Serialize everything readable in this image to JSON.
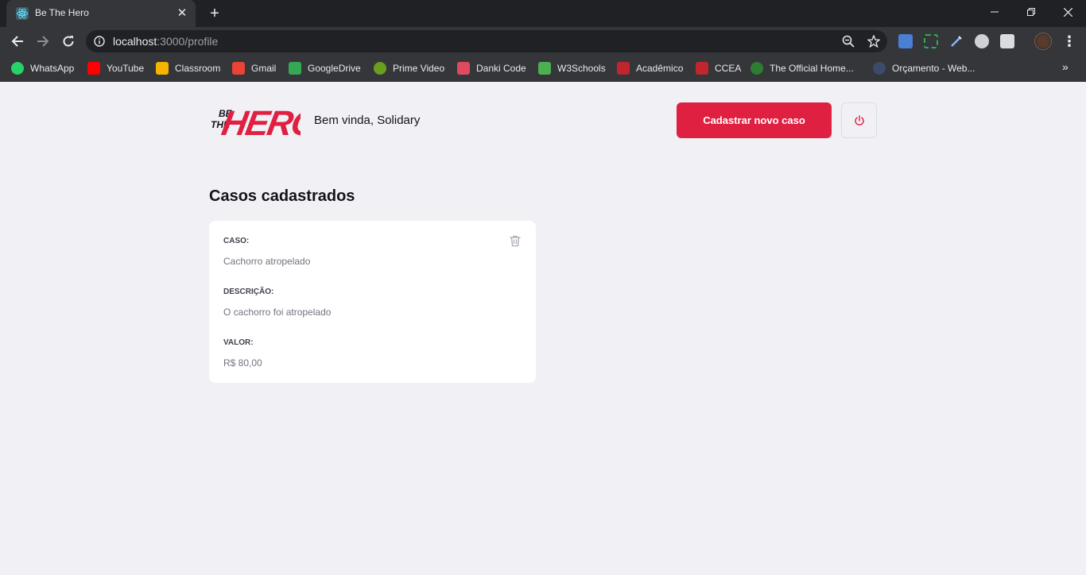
{
  "browser": {
    "tab_title": "Be The Hero",
    "url_host": "localhost",
    "url_path": ":3000/profile",
    "bookmarks": [
      {
        "label": "WhatsApp",
        "icon": "whatsapp-icon",
        "color": "#25d366"
      },
      {
        "label": "YouTube",
        "icon": "youtube-icon",
        "color": "#ff0000"
      },
      {
        "label": "Classroom",
        "icon": "classroom-icon",
        "color": "#f6b400"
      },
      {
        "label": "Gmail",
        "icon": "gmail-icon",
        "color": "#ea4335"
      },
      {
        "label": "GoogleDrive",
        "icon": "google-drive-icon",
        "color": "#34a853"
      },
      {
        "label": "Prime Video",
        "icon": "prime-video-icon",
        "color": "#6b9e1f"
      },
      {
        "label": "Danki Code",
        "icon": "code-icon",
        "color": "#e04a5f"
      },
      {
        "label": "W3Schools",
        "icon": "w3schools-icon",
        "color": "#4caf50"
      },
      {
        "label": "Acadêmico",
        "icon": "academico-icon",
        "color": "#c0262d"
      },
      {
        "label": "CCEA",
        "icon": "ccea-icon",
        "color": "#c0262d"
      },
      {
        "label": "The Official Home...",
        "icon": "official-home-icon",
        "color": "#2e7d32"
      },
      {
        "label": "Orçamento - Web...",
        "icon": "orcamento-icon",
        "color": "#3c4a6b"
      }
    ]
  },
  "header": {
    "logo_alt": "Be The Hero",
    "welcome": "Bem vinda, Solidary",
    "new_case_button": "Cadastrar novo caso"
  },
  "main": {
    "title": "Casos cadastrados",
    "cases": [
      {
        "case_label": "CASO:",
        "case_value": "Cachorro atropelado",
        "description_label": "DESCRIÇÃO:",
        "description_value": "O cachorro foi atropelado",
        "value_label": "VALOR:",
        "value_value": "R$ 80,00"
      }
    ]
  },
  "colors": {
    "accent": "#e02041",
    "background": "#f0f0f5",
    "text_dark": "#13131a",
    "text_label": "#41414d",
    "text_muted": "#737380"
  }
}
